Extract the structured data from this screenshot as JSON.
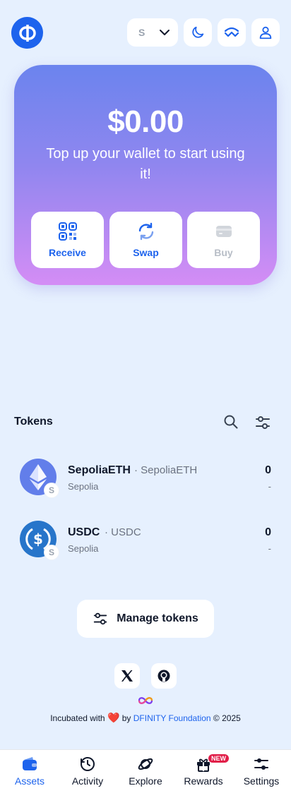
{
  "header": {
    "network_label": "S"
  },
  "hero": {
    "balance": "$0.00",
    "subtitle": "Top up your wallet to start using it!",
    "actions": [
      {
        "label": "Receive"
      },
      {
        "label": "Swap"
      },
      {
        "label": "Buy"
      }
    ]
  },
  "tokens": {
    "title": "Tokens",
    "items": [
      {
        "name": "SepoliaETH",
        "symbol": "· SepoliaETH",
        "network": "Sepolia",
        "balance": "0",
        "usd": "-",
        "badge": "S"
      },
      {
        "name": "USDC",
        "symbol": "· USDC",
        "network": "Sepolia",
        "balance": "0",
        "usd": "-",
        "badge": "S"
      }
    ],
    "manage_label": "Manage tokens"
  },
  "footer": {
    "prefix": "Incubated with",
    "heart": "❤️",
    "by": "by",
    "link": "DFINITY Foundation",
    "suffix": "© 2025"
  },
  "nav": {
    "items": [
      {
        "label": "Assets"
      },
      {
        "label": "Activity"
      },
      {
        "label": "Explore"
      },
      {
        "label": "Rewards"
      },
      {
        "label": "Settings"
      }
    ],
    "new_badge": "NEW"
  },
  "colors": {
    "accent": "#1d63ed",
    "background": "#e6f0fe",
    "hero_top": "#6b84ee",
    "hero_bottom": "#d48df5"
  }
}
